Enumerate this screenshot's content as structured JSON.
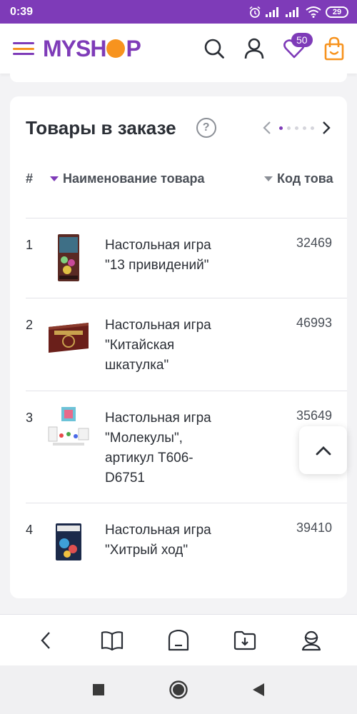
{
  "status_bar": {
    "time": "0:39",
    "battery": "29"
  },
  "header": {
    "logo_part1": "MYSH",
    "logo_part2": "P",
    "favorites_count": "50"
  },
  "order_items": {
    "title": "Товары в заказе",
    "help_label": "?",
    "columns": {
      "number": "#",
      "name": "Наименование товара",
      "code": "Код това"
    },
    "items": [
      {
        "number": "1",
        "name": "Настольная игра \"13 привидений\"",
        "code": "32469"
      },
      {
        "number": "2",
        "name": "Настольная игра \"Китайская шкатулка\"",
        "code": "46993"
      },
      {
        "number": "3",
        "name": "Настольная игра \"Молекулы\", артикул T606-D6751",
        "code": "35649"
      },
      {
        "number": "4",
        "name": "Настольная игра \"Хитрый ход\"",
        "code": "39410"
      }
    ]
  },
  "colors": {
    "brand_purple": "#7e3bb8",
    "brand_orange": "#f7931e",
    "text": "#2b2f36"
  },
  "icons": {
    "header": [
      "menu-icon",
      "search-icon",
      "user-icon",
      "heart-icon",
      "cart-bag-icon"
    ],
    "browser_bar": [
      "back-icon",
      "book-icon",
      "tabs-home-icon",
      "download-folder-icon",
      "profile-icon"
    ],
    "system_nav": [
      "recent-apps-icon",
      "home-icon",
      "back-triangle-icon"
    ]
  }
}
